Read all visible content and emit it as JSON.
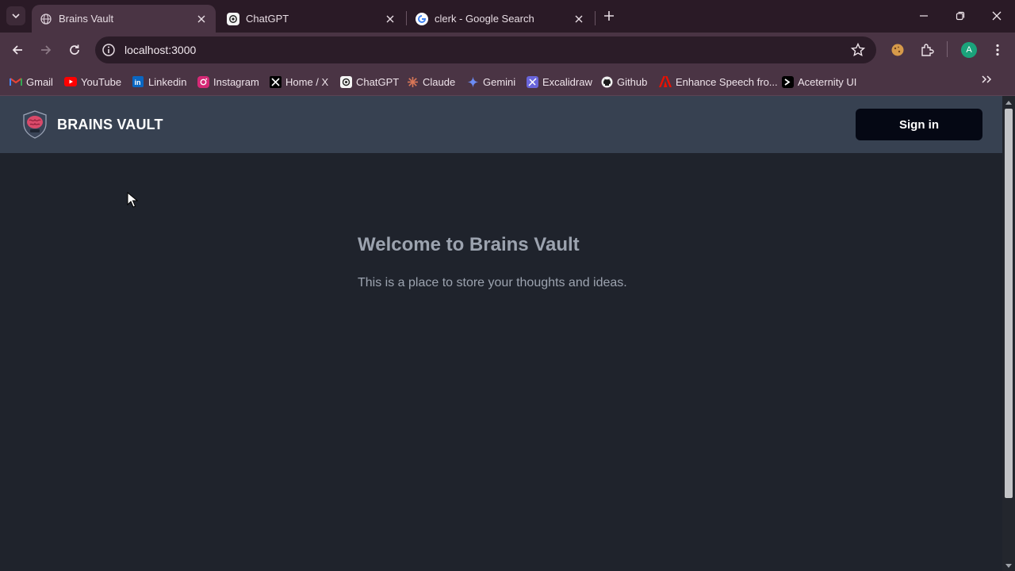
{
  "browser": {
    "tabs": [
      {
        "title": "Brains Vault",
        "active": true
      },
      {
        "title": "ChatGPT",
        "active": false
      },
      {
        "title": "clerk - Google Search",
        "active": false
      }
    ],
    "url": "localhost:3000",
    "profile_initial": "A",
    "bookmarks": [
      {
        "label": "Gmail",
        "icon": "gmail-icon"
      },
      {
        "label": "YouTube",
        "icon": "youtube-icon"
      },
      {
        "label": "Linkedin",
        "icon": "linkedin-icon"
      },
      {
        "label": "Instagram",
        "icon": "instagram-icon"
      },
      {
        "label": "Home / X",
        "icon": "x-icon"
      },
      {
        "label": "ChatGPT",
        "icon": "chatgpt-icon"
      },
      {
        "label": "Claude",
        "icon": "claude-icon"
      },
      {
        "label": "Gemini",
        "icon": "gemini-icon"
      },
      {
        "label": "Excalidraw",
        "icon": "excalidraw-icon"
      },
      {
        "label": "Github",
        "icon": "github-icon"
      },
      {
        "label": "Enhance Speech fro...",
        "icon": "adobe-icon"
      },
      {
        "label": "Aceternity UI",
        "icon": "aceternity-icon"
      }
    ]
  },
  "app": {
    "brand": "BRAINS VAULT",
    "signin_label": "Sign in",
    "welcome_title": "Welcome to Brains Vault",
    "tagline": "This is a place to store your thoughts and ideas."
  },
  "colors": {
    "header_bg": "#374151",
    "page_bg": "#1f232c",
    "button_bg": "#050814",
    "muted_text": "#9ca3af"
  }
}
